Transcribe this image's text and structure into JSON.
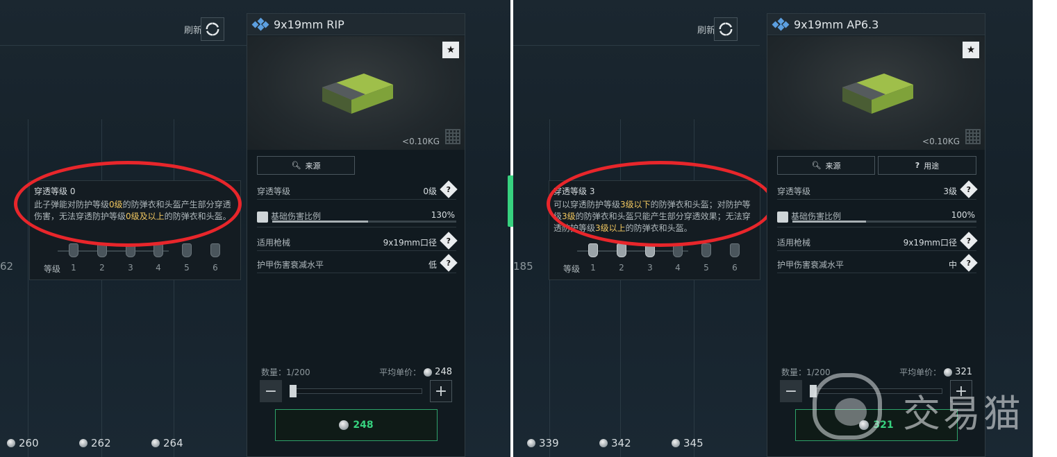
{
  "left": {
    "refresh_label": "刷新",
    "partial_number": "62",
    "bottom_prices": [
      "260",
      "262",
      "264"
    ],
    "tooltip": {
      "title": "穿透等级 0",
      "body_parts": [
        "此子弹能对防护等级",
        "0级",
        "的防弹衣和头盔产生部分穿透伤害，无法穿透防护等级",
        "0级及以上",
        "的防弹衣和头盔。"
      ],
      "level_label": "等级",
      "levels": [
        "1",
        "2",
        "3",
        "4",
        "5",
        "6"
      ],
      "active_levels": 0
    },
    "card": {
      "title": "9x19mm RIP",
      "weight": "<0.10KG",
      "buttons": [
        {
          "label": "来源",
          "icon": "search-icon"
        }
      ],
      "penetration_label": "穿透等级",
      "penetration_value": "0级",
      "damage_label": "基础伤害比例",
      "damage_value": "130%",
      "damage_fraction": 0.52,
      "weapon_label": "适用枪械",
      "weapon_value": "9x19mm口径",
      "armor_label": "护甲伤害衰减水平",
      "armor_value": "低",
      "qty_label": "数量：1/200",
      "avg_label": "平均单价：",
      "avg_value": "248",
      "buy_price": "248"
    }
  },
  "right": {
    "refresh_label": "刷新",
    "partial_number": "185",
    "bottom_prices": [
      "339",
      "342",
      "345"
    ],
    "tooltip": {
      "title": "穿透等级 3",
      "body_parts": [
        "可以穿透防护等级",
        "3级以下",
        "的防弹衣和头盔；对防护等级",
        "3级",
        "的防弹衣和头盔只能产生部分穿透效果；无法穿透防护等级",
        "3级以上",
        "的防弹衣和头盔。"
      ],
      "level_label": "等级",
      "levels": [
        "1",
        "2",
        "3",
        "4",
        "5",
        "6"
      ],
      "active_levels": 3
    },
    "card": {
      "title": "9x19mm AP6.3",
      "weight": "<0.10KG",
      "buttons": [
        {
          "label": "来源",
          "icon": "search-icon"
        },
        {
          "label": "用途",
          "icon": "question-icon"
        }
      ],
      "penetration_label": "穿透等级",
      "penetration_value": "3级",
      "damage_label": "基础伤害比例",
      "damage_value": "100%",
      "damage_fraction": 0.4,
      "weapon_label": "适用枪械",
      "weapon_value": "9x19mm口径",
      "armor_label": "护甲伤害衰减水平",
      "armor_value": "中",
      "qty_label": "数量：1/200",
      "avg_label": "平均单价：",
      "avg_value": "321",
      "buy_price": "321"
    }
  },
  "watermark_text": "交易猫",
  "colors": {
    "highlight": "#f1c760",
    "accent_green": "#37d27f",
    "annotation_red": "#e8262b",
    "rarity_blue": "#5c9fe0"
  }
}
